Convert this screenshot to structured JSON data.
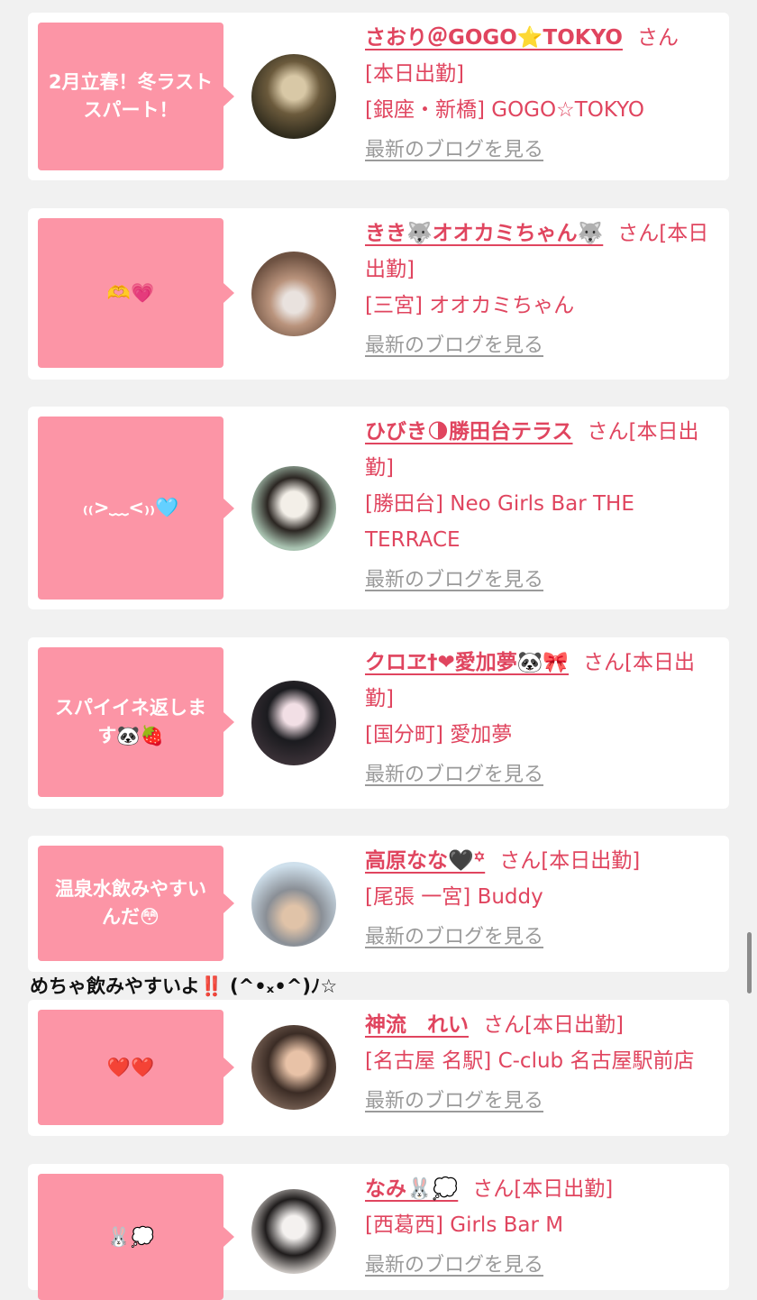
{
  "cards": [
    {
      "bubble": "2月立春！冬ラストスパート！",
      "name": "さおり＠GOGO⭐TOKYO",
      "san": "さん",
      "status": "[本日出勤]",
      "location": "[銀座・新橋] GOGO☆TOKYO",
      "blog": "最新のブログを見る"
    },
    {
      "bubble": "🫶💗",
      "name": "きき🐺オオカミちゃん🐺",
      "san": "さん[本日出勤]",
      "status": "",
      "location": "[三宮] オオカミちゃん",
      "blog": "最新のブログを見る"
    },
    {
      "bubble": "₍₍>﹏<₎₎🩵",
      "name": "ひびき🌗勝田台テラス",
      "san": "さん[本日出勤]",
      "status": "",
      "location": "[勝田台] Neo Girls Bar THE TERRACE",
      "blog": "最新のブログを見る"
    },
    {
      "bubble": "スパイイネ返します🐼🍓",
      "name": "クロヱ†❤愛加夢🐼🎀",
      "san": "さん[本日出勤]",
      "status": "",
      "location": "[国分町] 愛加夢",
      "blog": "最新のブログを見る"
    },
    {
      "bubble": "温泉水飲みやすいんだ😳",
      "name": "高原なな🖤꙳",
      "san": "さん[本日出勤]",
      "status": "",
      "location": "[尾張 一宮] Buddy",
      "blog": "最新のブログを見る"
    },
    {
      "bubble": "❤️❤️",
      "name": "神流　れい",
      "san": "さん[本日出勤]",
      "status": "",
      "location": "[名古屋 名駅] C-club 名古屋駅前店",
      "blog": "最新のブログを見る"
    },
    {
      "bubble": "🐰💭",
      "name": "なみ🐰💭",
      "san": "さん[本日出勤]",
      "status": "",
      "location": "[西葛西] Girls Bar M",
      "blog": "最新のブログを見る"
    }
  ],
  "overflow_comment": "めちゃ飲みやすいよ‼️ (^•ₓ•^)ﾉ☆",
  "colors": {
    "bubble": "#fc95a6",
    "accent": "#e0455f",
    "link_gray": "#9a9a9a",
    "page_bg": "#f1f1f1"
  }
}
